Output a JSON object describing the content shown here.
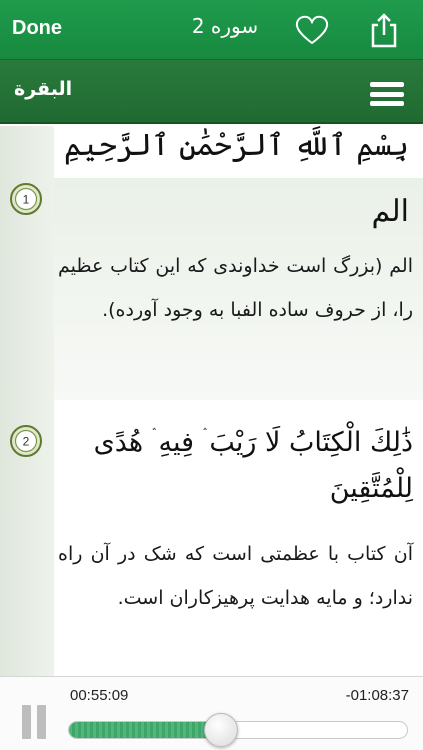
{
  "header": {
    "done_label": "Done",
    "surah_label": "سوره 2"
  },
  "subheader": {
    "sura_name": "البقرة"
  },
  "basmala": "بِسْمِ ٱللَّهِ ٱلرَّحْمَٰنِ ٱلرَّحِيمِ",
  "verses": [
    {
      "number": "1",
      "arabic": "الم",
      "translation": "الم (بزرگ است خداوندی که این کتاب عظیم را، از حروف ساده الفبا به وجود آورده)."
    },
    {
      "number": "2",
      "arabic": "ذَٰلِكَ الْكِتَابُ لَا رَيْبَ ۛ فِيهِ ۛ هُدًى لِلْمُتَّقِينَ",
      "translation": "آن کتاب با عظمتی است که شک در آن راه ندارد؛ و مایه هدایت پرهیزکاران است."
    }
  ],
  "player": {
    "elapsed": "00:55:09",
    "remaining": "-01:08:37",
    "progress": 0.45
  },
  "colors": {
    "accent": "#1f9b4c",
    "subbar": "#2a7a3c"
  }
}
